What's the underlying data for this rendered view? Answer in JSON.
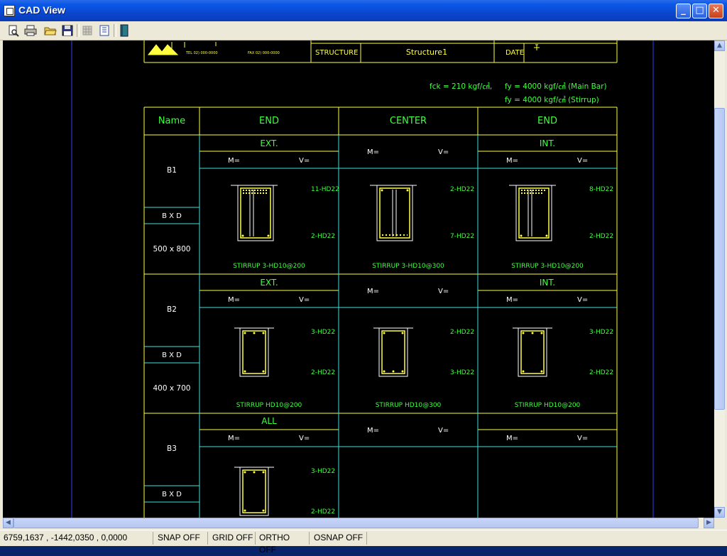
{
  "window": {
    "title": "CAD View"
  },
  "titlebar_buttons": {
    "minimize": "_",
    "maximize": "□",
    "close": "✕"
  },
  "toolbar": [
    "print-preview-icon",
    "print-icon",
    "open-folder-icon",
    "save-icon",
    "grid-toggle-icon",
    "layer-icon",
    "book-icon"
  ],
  "header": {
    "structure_label": "STRUCTURE",
    "structure_value": "Structure1",
    "date_label": "DATE",
    "logo_small_left": "TEL 02) 000-0000",
    "logo_small_right": "FAX 02) 000-0000"
  },
  "materials": {
    "fck": "fck = 210 kgf/㎠,",
    "fy_main": "fy = 4000 kgf/㎠ (Main Bar)",
    "fy_stirrup": "fy = 4000 kgf/㎠ (Stirrup)"
  },
  "table": {
    "col_headers": [
      "Name",
      "END",
      "CENTER",
      "END"
    ],
    "m_label": "M=",
    "v_label": "V=",
    "bxd_label": "B X D",
    "beams": [
      {
        "name": "B1",
        "size": "500 x 800",
        "left_label": "EXT.",
        "right_label": "INT.",
        "sections": [
          {
            "top": "11-HD22",
            "bottom": "2-HD22",
            "stirrup": "STIRRUP  3-HD10@200"
          },
          {
            "top": "2-HD22",
            "bottom": "7-HD22",
            "stirrup": "STIRRUP  3-HD10@300"
          },
          {
            "top": "8-HD22",
            "bottom": "2-HD22",
            "stirrup": "STIRRUP  3-HD10@200"
          }
        ]
      },
      {
        "name": "B2",
        "size": "400 x 700",
        "left_label": "EXT.",
        "right_label": "INT.",
        "sections": [
          {
            "top": "3-HD22",
            "bottom": "2-HD22",
            "stirrup": "STIRRUP  HD10@200"
          },
          {
            "top": "2-HD22",
            "bottom": "3-HD22",
            "stirrup": "STIRRUP  HD10@300"
          },
          {
            "top": "3-HD22",
            "bottom": "2-HD22",
            "stirrup": "STIRRUP  HD10@200"
          }
        ]
      },
      {
        "name": "B3",
        "size": "",
        "left_label": "ALL",
        "right_label": "",
        "sections": [
          {
            "top": "3-HD22",
            "bottom": "2-HD22",
            "stirrup": ""
          }
        ]
      }
    ]
  },
  "colors": {
    "yellow": "#ffff40",
    "cyan": "#40e0e0",
    "green": "#40ff40",
    "white": "#ffffff"
  },
  "statusbar": {
    "coords": "6759,1637 , -1442,0350 , 0,0000",
    "snap": "SNAP OFF",
    "grid": "GRID OFF",
    "ortho": "ORTHO OFF",
    "osnap": "OSNAP OFF"
  }
}
